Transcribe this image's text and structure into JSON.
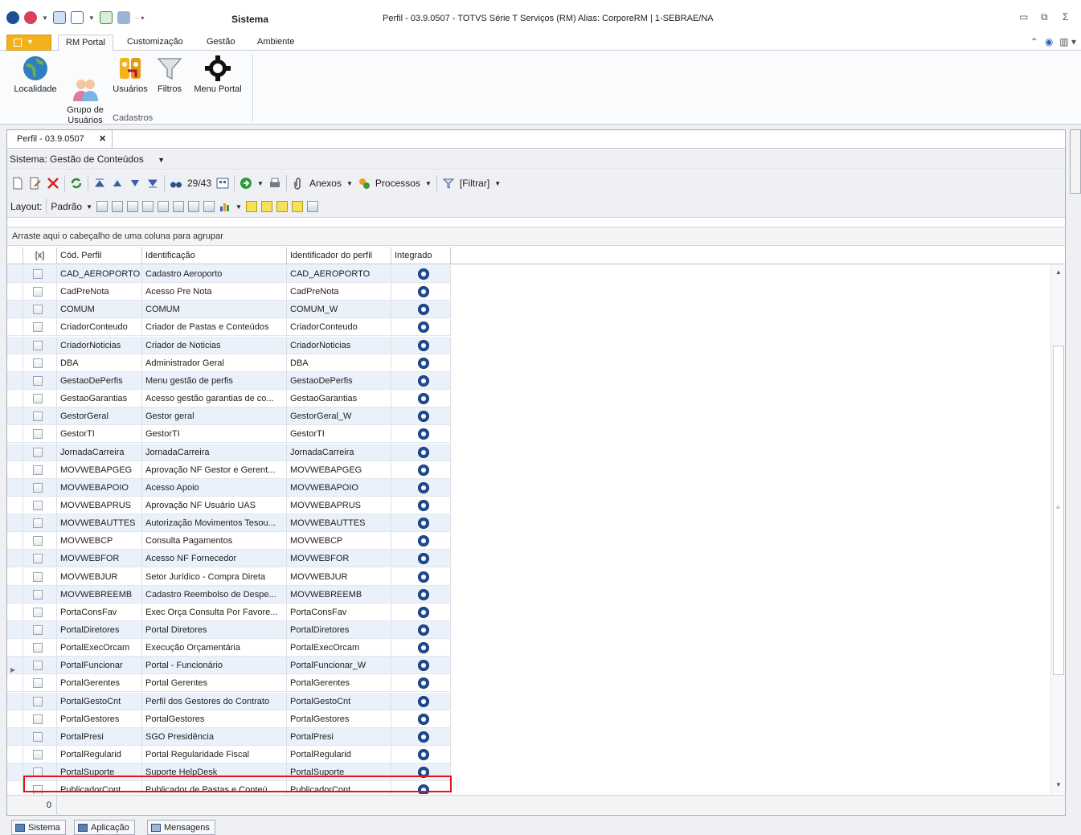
{
  "window": {
    "sistema_label": "Sistema",
    "title": "Perfil - 03.9.0507 - TOTVS Série T Serviços (RM) Alias: CorporeRM | 1-SEBRAE/NA"
  },
  "ribbon": {
    "tabs": [
      "RM Portal",
      "Customização",
      "Gestão",
      "Ambiente"
    ],
    "active_tab": "RM Portal",
    "buttons": [
      {
        "label": "Localidade",
        "icon": "globe-icon"
      },
      {
        "label": "Grupo de\nUsuários",
        "icon": "user-group-icon"
      },
      {
        "label": "Usuários",
        "icon": "users-key-icon"
      },
      {
        "label": "Filtros",
        "icon": "funnel-icon"
      },
      {
        "label": "Menu Portal",
        "icon": "gear-icon"
      }
    ],
    "group_label": "Cadastros"
  },
  "document": {
    "tab_label": "Perfil - 03.9.0507",
    "sistema_row": "Sistema:  Gestão de Conteúdos",
    "record_counter": "29/43",
    "anexos_label": "Anexos",
    "processos_label": "Processos",
    "filtrar_label": "[Filtrar]",
    "layout_label": "Layout:",
    "layout_value": "Padrão",
    "group_hint": "Arraste aqui o cabeçalho de uma coluna para agrupar",
    "footer_count": "0"
  },
  "grid": {
    "columns": [
      "[x]",
      "Cód. Perfil",
      "Identificação",
      "Identificador do perfil",
      "Integrado"
    ],
    "selected_row": 22,
    "rows": [
      [
        "CAD_AEROPORTO",
        "Cadastro Aeroporto",
        "CAD_AEROPORTO"
      ],
      [
        "CadPreNota",
        "Acesso Pre Nota",
        "CadPreNota"
      ],
      [
        "COMUM",
        "COMUM",
        "COMUM_W"
      ],
      [
        "CriadorConteudo",
        "Criador de Pastas e Conteúdos",
        "CriadorConteudo"
      ],
      [
        "CriadorNoticias",
        "Criador de Noticias",
        "CriadorNoticias"
      ],
      [
        "DBA",
        "Administrador Geral",
        "DBA"
      ],
      [
        "GestaoDePerfis",
        "Menu gestão de perfis",
        "GestaoDePerfis"
      ],
      [
        "GestaoGarantias",
        "Acesso gestão garantias de co...",
        "GestaoGarantias"
      ],
      [
        "GestorGeral",
        "Gestor geral",
        "GestorGeral_W"
      ],
      [
        "GestorTI",
        "GestorTI",
        "GestorTI"
      ],
      [
        "JornadaCarreira",
        "JornadaCarreira",
        "JornadaCarreira"
      ],
      [
        "MOVWEBAPGEG",
        "Aprovação NF Gestor e Gerent...",
        "MOVWEBAPGEG"
      ],
      [
        "MOVWEBAPOIO",
        "Acesso Apoio",
        "MOVWEBAPOIO"
      ],
      [
        "MOVWEBAPRUS",
        "Aprovação NF Usuário UAS",
        "MOVWEBAPRUS"
      ],
      [
        "MOVWEBAUTTES",
        "Autorização Movimentos Tesou...",
        "MOVWEBAUTTES"
      ],
      [
        "MOVWEBCP",
        "Consulta Pagamentos",
        "MOVWEBCP"
      ],
      [
        "MOVWEBFOR",
        "Acesso NF Fornecedor",
        "MOVWEBFOR"
      ],
      [
        "MOVWEBJUR",
        "Setor Jurídico - Compra Direta",
        "MOVWEBJUR"
      ],
      [
        "MOVWEBREEMB",
        "Cadastro Reembolso de Despe...",
        "MOVWEBREEMB"
      ],
      [
        "PortaConsFav",
        "Exec Orça Consulta Por Favore...",
        "PortaConsFav"
      ],
      [
        "PortalDiretores",
        "Portal Diretores",
        "PortalDiretores"
      ],
      [
        "PortalExecOrcam",
        "Execução Orçamentária",
        "PortalExecOrcam"
      ],
      [
        "PortalFuncionar",
        "Portal - Funcionário",
        "PortalFuncionar_W"
      ],
      [
        "PortalGerentes",
        "Portal Gerentes",
        "PortalGerentes"
      ],
      [
        "PortalGestoCnt",
        "Perfil dos Gestores do Contrato",
        "PortalGestoCnt"
      ],
      [
        "PortalGestores",
        "PortalGestores",
        "PortalGestores"
      ],
      [
        "PortalPresi",
        "SGO Presidência",
        "PortalPresi"
      ],
      [
        "PortalRegularid",
        "Portal Regularidade Fiscal",
        "PortalRegularid"
      ],
      [
        "PortalSuporte",
        "Suporte HelpDesk",
        "PortalSuporte"
      ],
      [
        "PublicadorCont",
        "Publicador de Pastas e Conteú...",
        "PublicadorCont"
      ]
    ]
  },
  "bottom_tabs": [
    "Sistema",
    "Aplicação",
    "Mensagens"
  ],
  "colors": {
    "accent": "#f2b21b",
    "highlight": "#e0131a",
    "alt_row": "#eaf1fb"
  }
}
